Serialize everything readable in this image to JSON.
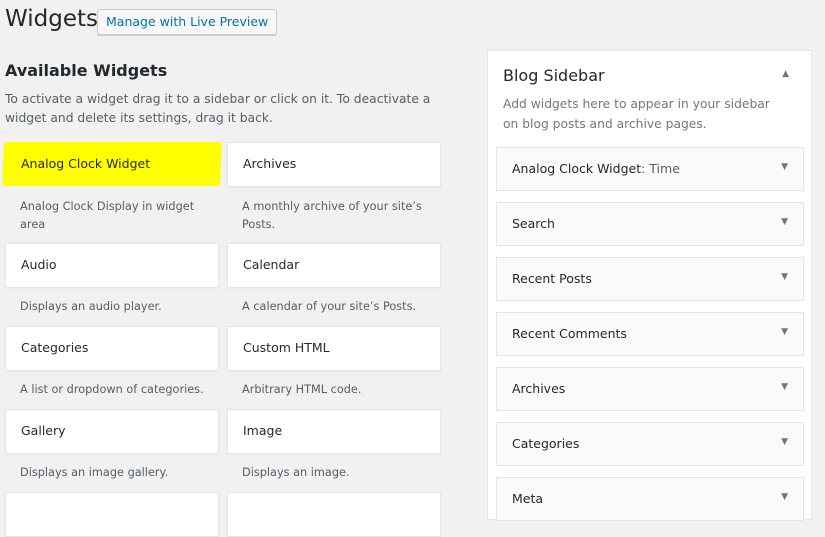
{
  "header": {
    "title": "Widgets",
    "preview_button": "Manage with Live Preview"
  },
  "available": {
    "title": "Available Widgets",
    "description": "To activate a widget drag it to a sidebar or click on it. To deactivate a widget and delete its settings, drag it back.",
    "widgets": [
      {
        "name": "Analog Clock Widget",
        "desc": "Analog Clock Display in widget area"
      },
      {
        "name": "Archives",
        "desc": "A monthly archive of your site’s Posts."
      },
      {
        "name": "Audio",
        "desc": "Displays an audio player."
      },
      {
        "name": "Calendar",
        "desc": "A calendar of your site’s Posts."
      },
      {
        "name": "Categories",
        "desc": "A list or dropdown of categories."
      },
      {
        "name": "Custom HTML",
        "desc": "Arbitrary HTML code."
      },
      {
        "name": "Gallery",
        "desc": "Displays an image gallery."
      },
      {
        "name": "Image",
        "desc": "Displays an image."
      }
    ]
  },
  "sidebar": {
    "title": "Blog Sidebar",
    "description": "Add widgets here to appear in your sidebar on blog posts and archive pages.",
    "widgets": [
      {
        "title": "Analog Clock Widget",
        "subtitle": ": Time"
      },
      {
        "title": "Search"
      },
      {
        "title": "Recent Posts"
      },
      {
        "title": "Recent Comments"
      },
      {
        "title": "Archives"
      },
      {
        "title": "Categories"
      },
      {
        "title": "Meta"
      }
    ]
  },
  "icons": {
    "collapse": "triangle-up-icon",
    "expand": "triangle-down-icon"
  },
  "colors": {
    "highlight": "#ffff00",
    "link": "#0073aa",
    "background": "#f1f1f1"
  }
}
